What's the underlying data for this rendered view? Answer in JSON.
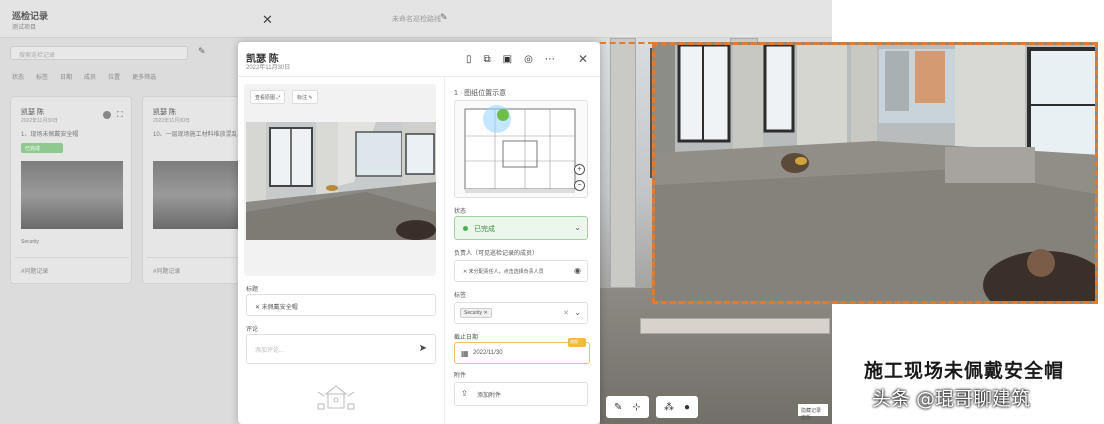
{
  "background": {
    "title": "巡检记录",
    "subtitle": "测试项目",
    "close_icon": "close-icon",
    "center_label": "未命名巡检路线",
    "search_placeholder": "搜索巡检记录",
    "filters": [
      "状态",
      "标签",
      "日期",
      "成员",
      "位置",
      "更多筛选"
    ],
    "cards": [
      {
        "name": "凯瑟 陈",
        "date": "2022年11月30日",
        "desc": "1、现场未佩戴安全帽",
        "badge": "已完成",
        "tag": "Security",
        "footer": "#问题记录",
        "photo": "photo-a"
      },
      {
        "name": "凯瑟 陈",
        "date": "2022年11月30日",
        "desc": "10、一层现场施工材料堆放混乱",
        "badge": "",
        "tag": "",
        "footer": "#问题记录",
        "photo": "photo-b"
      }
    ],
    "view_button": "隐藏记录面板"
  },
  "panel": {
    "name": "凯瑟 陈",
    "date": "2022年11月30日",
    "header_icons": [
      "pdf-icon",
      "share-icon",
      "edit-icon",
      "history-icon",
      "more-icon"
    ],
    "image_chips": [
      "查看原图",
      "标注"
    ],
    "title_label": "标题",
    "title_value": "未佩戴安全帽",
    "comment_label": "评论",
    "comment_placeholder": "添加评论...",
    "plan_title": "1 · 图纸位置示意",
    "status_label": "状态",
    "status_value": "已完成",
    "assignee_label": "负责人（可见巡检记录的成员）",
    "assignee_value": "未分配责任人，点击选择负责人员",
    "tags_label": "标签",
    "tag_value": "Security",
    "due_label": "截止日期",
    "due_value": "2022/11/30",
    "due_flag": "逾期",
    "attach_label": "附件",
    "attach_value": "添加附件"
  },
  "colors": {
    "accent_orange": "#e07b30",
    "status_green": "#4caf50"
  },
  "caption": "施工现场未佩戴安全帽",
  "watermark": "头条 @琨哥聊建筑"
}
